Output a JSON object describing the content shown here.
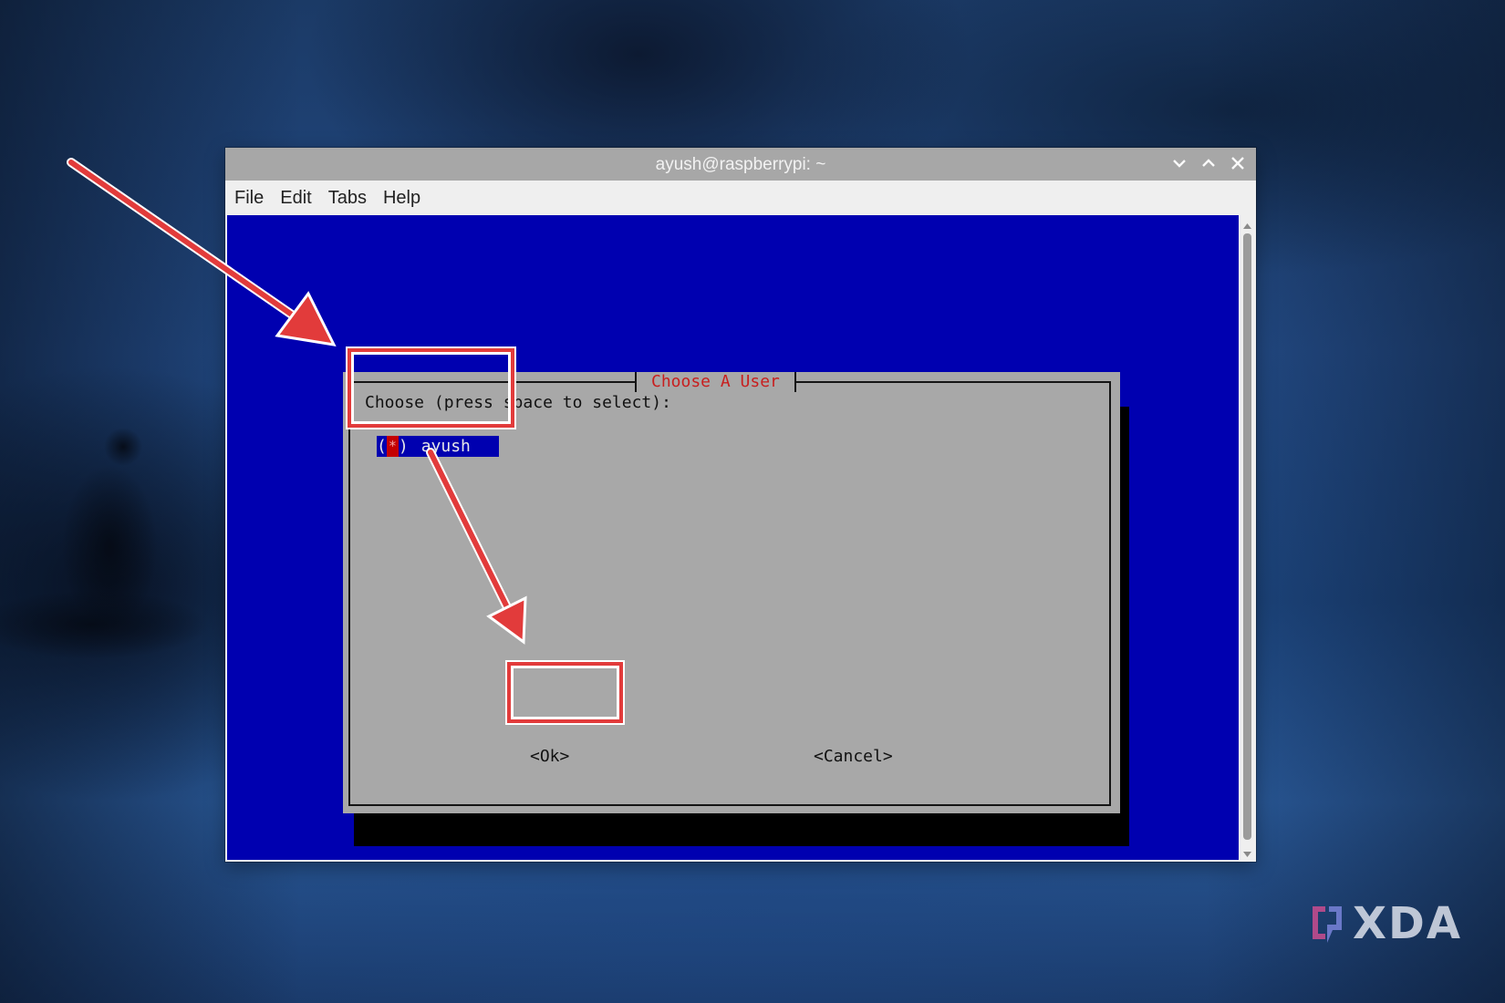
{
  "window": {
    "title": "ayush@raspberrypi: ~"
  },
  "menu": {
    "items": [
      "File",
      "Edit",
      "Tabs",
      "Help"
    ]
  },
  "dialog": {
    "title": "Choose A User",
    "prompt": "Choose (press space to select):",
    "option": {
      "open": "(",
      "mark": "*",
      "close": ")",
      "label": "ayush",
      "selected": true
    },
    "ok_label": "<Ok>",
    "cancel_label": "<Cancel>"
  },
  "watermark": {
    "text": "XDA"
  },
  "colors": {
    "terminal_bg": "#0000b0",
    "dialog_bg": "#a8a8a8",
    "dialog_title": "#c81e1e",
    "annotation": "#e23b3b"
  }
}
